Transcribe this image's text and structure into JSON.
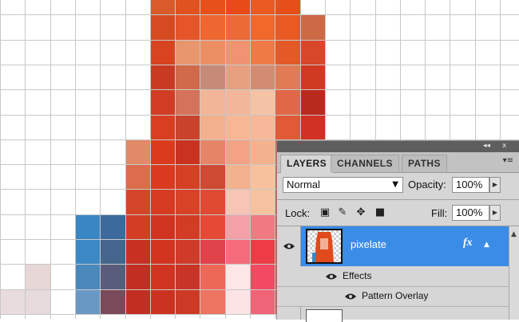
{
  "canvas": {
    "background": "#ffffff",
    "gridline": "#c8c8c8",
    "pixels": [
      [
        "#ffffff",
        "#ffffff",
        "#ffffff",
        "#ffffff",
        "#ffffff",
        "#ffffff",
        "#d95a2b",
        "#e0521f",
        "#e8501a",
        "#e84a18",
        "#eb5a20",
        "#e64f17",
        "#ffffff",
        "#ffffff",
        "#ffffff",
        "#ffffff",
        "#ffffff",
        "#ffffff",
        "#ffffff",
        "#ffffff",
        "#ffffff"
      ],
      [
        "#ffffff",
        "#ffffff",
        "#ffffff",
        "#ffffff",
        "#ffffff",
        "#ffffff",
        "#d64a22",
        "#e6552a",
        "#ee6630",
        "#eb6a35",
        "#f2672a",
        "#e95a22",
        "#cd6a45",
        "#ffffff",
        "#ffffff",
        "#ffffff",
        "#ffffff",
        "#ffffff",
        "#ffffff",
        "#ffffff",
        "#ffffff"
      ],
      [
        "#ffffff",
        "#ffffff",
        "#ffffff",
        "#ffffff",
        "#ffffff",
        "#ffffff",
        "#d8441f",
        "#e8966e",
        "#eb8f62",
        "#ef9372",
        "#f07a45",
        "#e45a26",
        "#d8472a",
        "#ffffff",
        "#ffffff",
        "#ffffff",
        "#ffffff",
        "#ffffff",
        "#ffffff",
        "#ffffff",
        "#ffffff"
      ],
      [
        "#ffffff",
        "#ffffff",
        "#ffffff",
        "#ffffff",
        "#ffffff",
        "#ffffff",
        "#c93a22",
        "#d06a4a",
        "#c58a78",
        "#e6a080",
        "#d38c74",
        "#e07b56",
        "#d03a22",
        "#ffffff",
        "#ffffff",
        "#ffffff",
        "#ffffff",
        "#ffffff",
        "#ffffff",
        "#ffffff",
        "#ffffff"
      ],
      [
        "#ffffff",
        "#ffffff",
        "#ffffff",
        "#ffffff",
        "#ffffff",
        "#ffffff",
        "#d03c24",
        "#d4735a",
        "#f2b597",
        "#f2b69a",
        "#f4c3a6",
        "#e06848",
        "#b92a1e",
        "#ffffff",
        "#ffffff",
        "#ffffff",
        "#ffffff",
        "#ffffff",
        "#ffffff",
        "#ffffff",
        "#ffffff"
      ],
      [
        "#ffffff",
        "#ffffff",
        "#ffffff",
        "#ffffff",
        "#ffffff",
        "#ffffff",
        "#da3e22",
        "#c9432c",
        "#f2b08c",
        "#f7b795",
        "#f6b898",
        "#e05a36",
        "#d13024",
        "#ffffff",
        "#ffffff",
        "#ffffff",
        "#ffffff",
        "#ffffff",
        "#ffffff",
        "#ffffff",
        "#ffffff"
      ],
      [
        "#ffffff",
        "#ffffff",
        "#ffffff",
        "#ffffff",
        "#ffffff",
        "#e08a6a",
        "#dc3a1c",
        "#c8321e",
        "#e68468",
        "#f4a286",
        "#f4b18e",
        "#e8562e",
        "#e03b1c",
        "#ffffff",
        "#ffffff",
        "#ffffff",
        "#ffffff",
        "#ffffff",
        "#ffffff",
        "#ffffff",
        "#ffffff"
      ],
      [
        "#ffffff",
        "#ffffff",
        "#ffffff",
        "#ffffff",
        "#ffffff",
        "#dc6c4c",
        "#da3a20",
        "#d44024",
        "#cf4a32",
        "#f4b18e",
        "#f8c19e",
        "#e6562f",
        "#e03b1c",
        "#ffffff",
        "#ffffff",
        "#ffffff",
        "#ffffff",
        "#ffffff",
        "#ffffff",
        "#ffffff",
        "#ffffff"
      ],
      [
        "#ffffff",
        "#ffffff",
        "#ffffff",
        "#ffffff",
        "#ffffff",
        "#d4462a",
        "#d63a20",
        "#d84226",
        "#de4a32",
        "#f7c4b6",
        "#f6c3a0",
        "#e04a2c",
        "#e2401e",
        "#ffffff",
        "#ffffff",
        "#ffffff",
        "#ffffff",
        "#ffffff",
        "#ffffff",
        "#ffffff",
        "#ffffff"
      ],
      [
        "#ffffff",
        "#ffffff",
        "#ffffff",
        "#3a86c2",
        "#3c6a9c",
        "#d23e24",
        "#d03420",
        "#d23c24",
        "#e54a36",
        "#f5a0a8",
        "#f07a80",
        "#e64030",
        "#e03b1c",
        "#ffffff",
        "#ffffff",
        "#ffffff",
        "#ffffff",
        "#ffffff",
        "#ffffff",
        "#ffffff",
        "#ffffff"
      ],
      [
        "#ffffff",
        "#ffffff",
        "#ffffff",
        "#3c88c4",
        "#44668c",
        "#c83022",
        "#d23420",
        "#d03a28",
        "#e0424a",
        "#f46c7c",
        "#ee3c46",
        "#e23a2e",
        "#e03b1c",
        "#ffffff",
        "#ffffff",
        "#ffffff",
        "#ffffff",
        "#ffffff",
        "#ffffff",
        "#ffffff",
        "#ffffff"
      ],
      [
        "#ffffff",
        "#e6d6d6",
        "#ffffff",
        "#4a88bc",
        "#5a5c7c",
        "#c32e22",
        "#d03420",
        "#c83426",
        "#ee6858",
        "#fde6e6",
        "#f24a60",
        "#e23a2e",
        "#e03b1c",
        "#ffffff",
        "#ffffff",
        "#ffffff",
        "#ffffff",
        "#ffffff",
        "#ffffff",
        "#ffffff",
        "#ffffff"
      ],
      [
        "#e8dcdc",
        "#e6dada",
        "#ffffff",
        "#6a98c4",
        "#7a4a5a",
        "#c22e22",
        "#cc3220",
        "#cc3a26",
        "#ec7460",
        "#fce4e4",
        "#f06478",
        "#e23a2e",
        "#e03b1c",
        "#ffffff",
        "#ffffff",
        "#ffffff",
        "#ffffff",
        "#ffffff",
        "#ffffff",
        "#ffffff",
        "#ffffff"
      ]
    ]
  },
  "panel": {
    "title_controls": {
      "collapse": "◂◂",
      "close": "x"
    },
    "tabs": [
      {
        "label": "LAYERS",
        "active": true
      },
      {
        "label": "CHANNELS",
        "active": false
      },
      {
        "label": "PATHS",
        "active": false
      }
    ],
    "menu_icon": "panel-menu-icon",
    "blend_mode": "Normal",
    "opacity_label": "Opacity:",
    "opacity_value": "100%",
    "lock_label": "Lock:",
    "lock_icons": [
      "lock-transparent-icon",
      "lock-brush-icon",
      "lock-move-icon",
      "lock-all-icon"
    ],
    "fill_label": "Fill:",
    "fill_value": "100%",
    "layer": {
      "name": "pixelate",
      "fx": "fx",
      "selected_color": "#3b8ce6"
    },
    "effects_label": "Effects",
    "effect_items": [
      "Pattern Overlay"
    ]
  }
}
